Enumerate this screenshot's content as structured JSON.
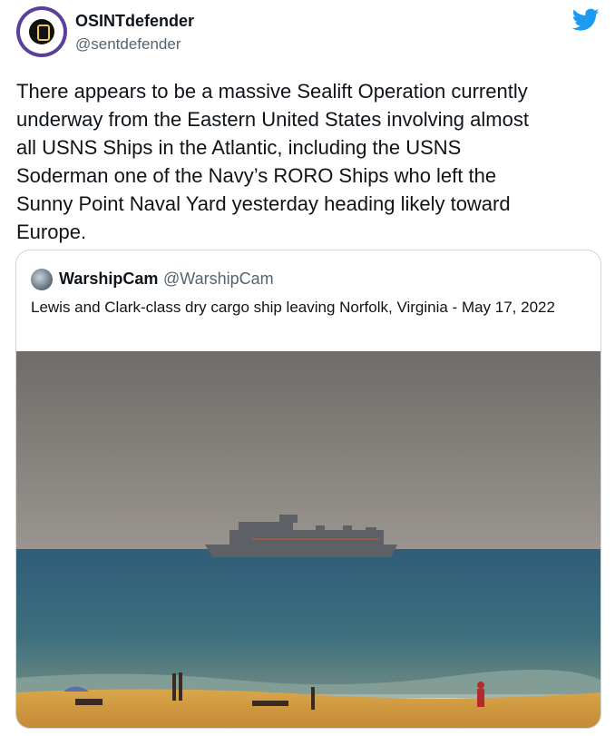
{
  "tweet": {
    "author_name": "OSINTdefender",
    "author_handle": "@sentdefender",
    "text": "There appears to be a massive Sealift Operation currently\nunderway from the Eastern United States involving almost\nall USNS Ships in the Atlantic, including the USNS\nSoderman one of the Navy’s RORO Ships who left the\nSunny Point Naval Yard yesterday heading likely toward\nEurope."
  },
  "quoted_tweet": {
    "author_name": "WarshipCam",
    "author_handle": "@WarshipCam",
    "text": "Lewis and Clark-class dry cargo ship leaving Norfolk, Virginia - May 17, 2022"
  },
  "icons": {
    "brand": "twitter-bird-icon",
    "brand_color": "#1d9bf0"
  },
  "colors": {
    "text_primary": "#0f1419",
    "text_secondary": "#536471",
    "border": "#cfd9de"
  }
}
